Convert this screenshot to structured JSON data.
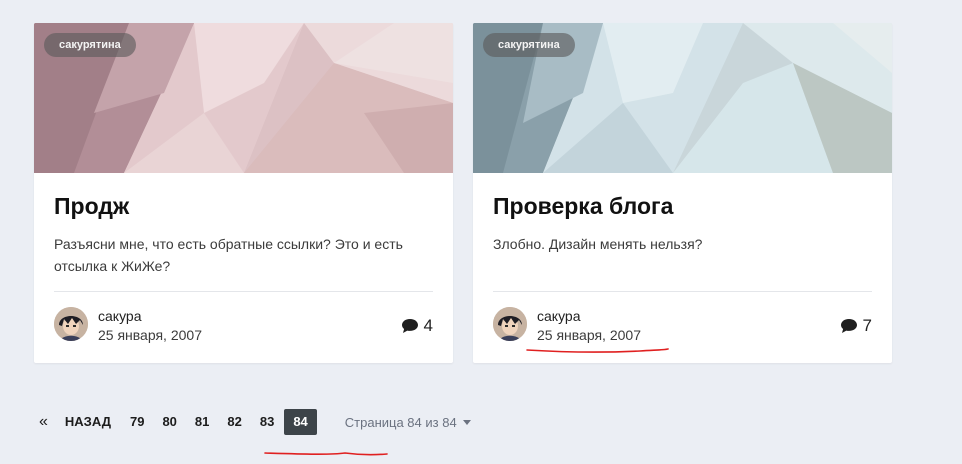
{
  "posts": [
    {
      "tag": "сакурятина",
      "title": "Продж",
      "excerpt": "Разъясни мне, что есть обратные ссылки? Это и есть отсылка к ЖиЖе?",
      "author": "сакура",
      "date": "25 января, 2007",
      "comment_count": "4",
      "cover_colors": [
        "#b08a94",
        "#e8d0d3",
        "#d9b7ba"
      ]
    },
    {
      "tag": "сакурятина",
      "title": "Проверка блога",
      "excerpt": "Злобно. Дизайн менять нельзя?",
      "author": "сакура",
      "date": "25 января, 2007",
      "comment_count": "7",
      "cover_colors": [
        "#8a9fa9",
        "#d9e8ee",
        "#b9c5c3"
      ]
    }
  ],
  "pagination": {
    "first_symbol": "«",
    "prev_label": "НАЗАД",
    "pages": [
      "79",
      "80",
      "81",
      "82",
      "83"
    ],
    "current": "84",
    "jump_label": "Страница 84 из 84"
  },
  "icons": {
    "comment": "comment-bubble-icon",
    "avatar": "user-avatar",
    "dropdown": "caret-down-icon"
  },
  "colors": {
    "background": "#ebeef4",
    "active_page": "#3d4449",
    "annotation_underline": "#e02020"
  }
}
